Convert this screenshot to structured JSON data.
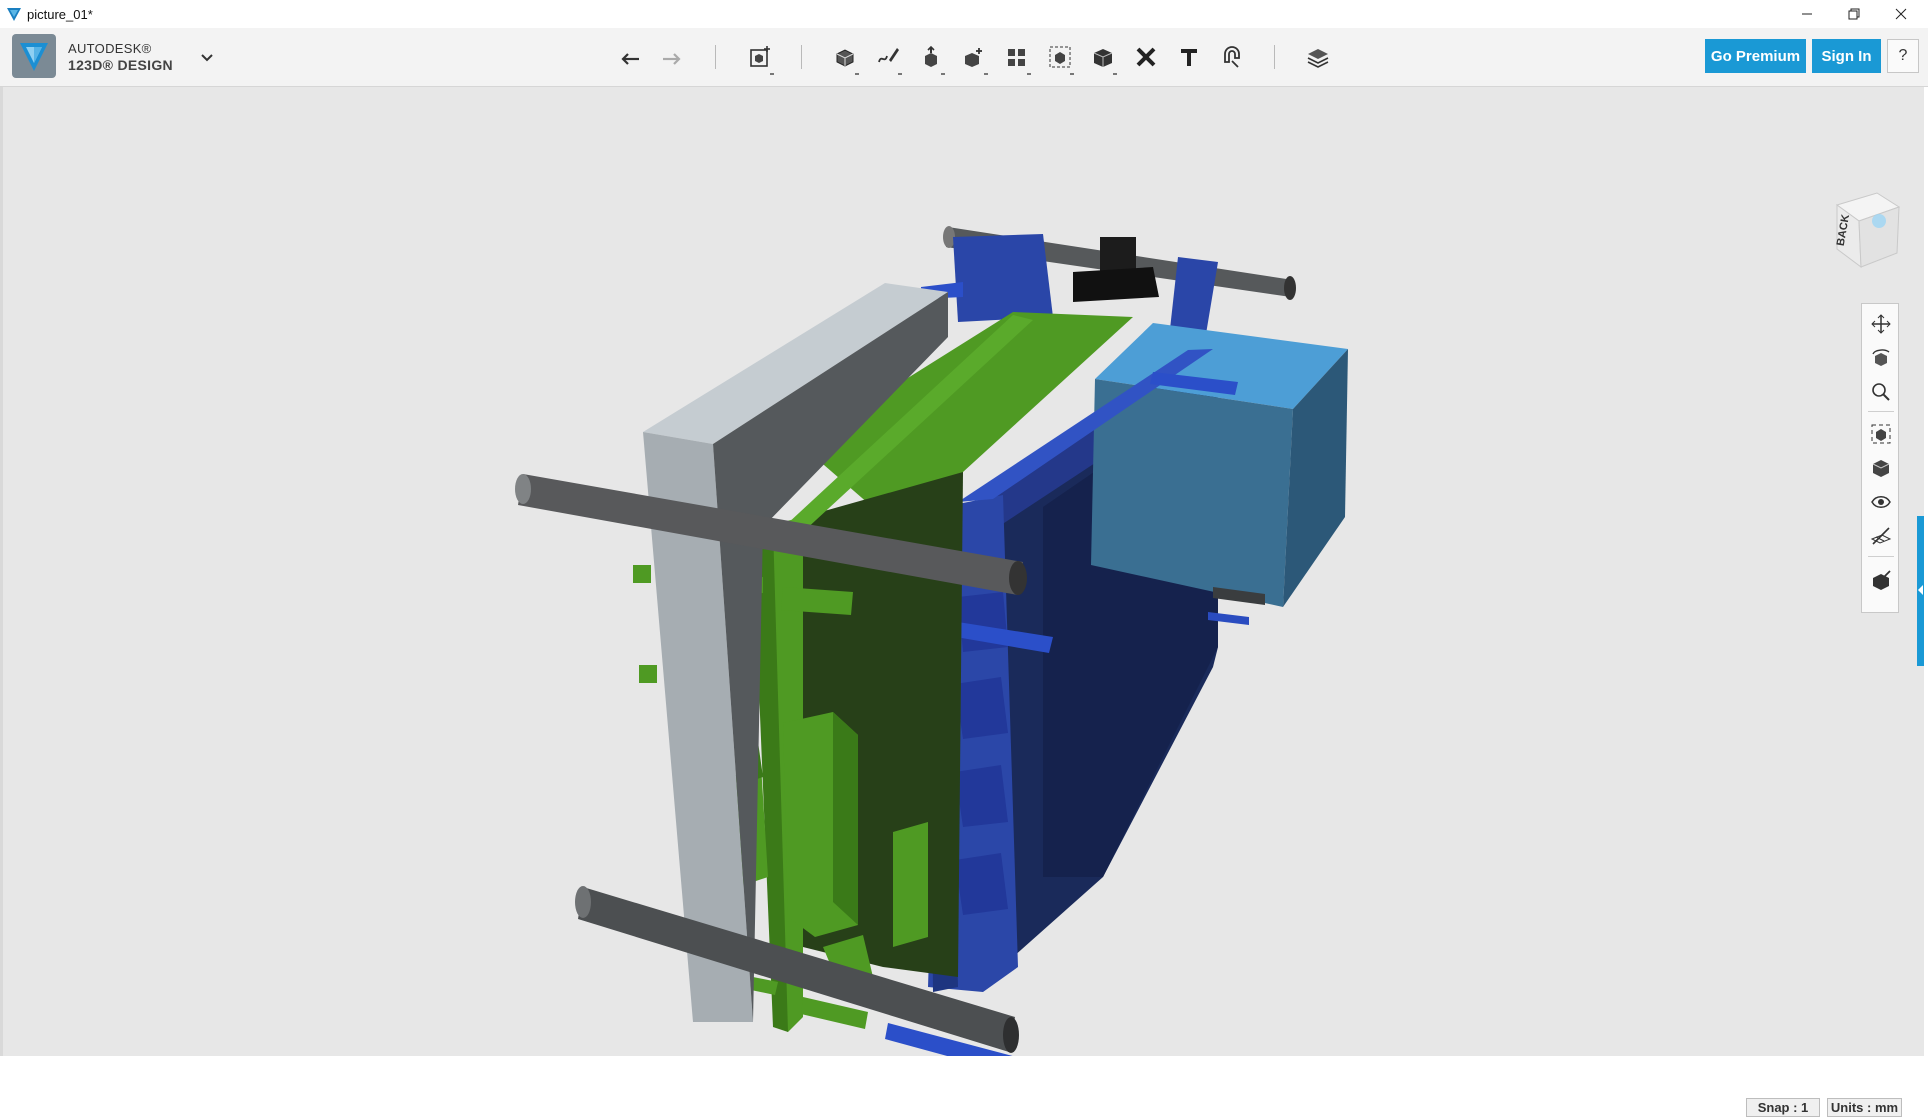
{
  "window": {
    "title": "picture_01*",
    "icons": {
      "app": "autodesk-v-icon",
      "minimize": "minimize-icon",
      "restore": "restore-icon",
      "close": "close-icon"
    }
  },
  "brand": {
    "line1": "AUTODESK®",
    "line2": "123D® DESIGN",
    "menu_icon": "chevron-down-icon"
  },
  "toolbar": {
    "tools": [
      {
        "name": "undo",
        "icon": "undo-arrow-icon"
      },
      {
        "name": "redo",
        "icon": "redo-arrow-icon"
      },
      {
        "name": "transform",
        "icon": "transform-box-icon"
      },
      {
        "name": "primitives",
        "icon": "primitives-icon"
      },
      {
        "name": "sketch",
        "icon": "sketch-pen-icon"
      },
      {
        "name": "construct",
        "icon": "construct-icon"
      },
      {
        "name": "modify",
        "icon": "modify-icon"
      },
      {
        "name": "pattern",
        "icon": "pattern-grid-icon"
      },
      {
        "name": "grouping",
        "icon": "group-icon"
      },
      {
        "name": "combine",
        "icon": "combine-cube-icon"
      },
      {
        "name": "delete",
        "icon": "delete-x-icon"
      },
      {
        "name": "text",
        "icon": "text-t-icon"
      },
      {
        "name": "snap",
        "icon": "snap-magnet-icon"
      },
      {
        "name": "materials",
        "icon": "layers-icon"
      }
    ]
  },
  "buttons": {
    "premium": "Go Premium",
    "signin": "Sign In",
    "help": "?"
  },
  "viewcube": {
    "face": "BACK"
  },
  "navbar": {
    "tools": [
      {
        "name": "pan",
        "icon": "pan-arrows-icon"
      },
      {
        "name": "orbit",
        "icon": "orbit-icon"
      },
      {
        "name": "zoom",
        "icon": "zoom-magnifier-icon"
      },
      {
        "name": "fit",
        "icon": "fit-view-icon"
      },
      {
        "name": "view-mode",
        "icon": "shaded-cube-icon"
      },
      {
        "name": "visibility",
        "icon": "eye-icon"
      },
      {
        "name": "grid",
        "icon": "grid-toggle-icon"
      },
      {
        "name": "materials-view",
        "icon": "material-cube-icon"
      }
    ]
  },
  "status": {
    "snap": "Snap : 1",
    "units": "Units : mm"
  },
  "colors": {
    "accent": "#1a99d5",
    "viewport": "#e7e7e7",
    "blue_part": "#2b47a8",
    "green_part": "#4f9a23",
    "light_blue_block": "#4f9fd2",
    "gray_rod": "#55585a"
  }
}
